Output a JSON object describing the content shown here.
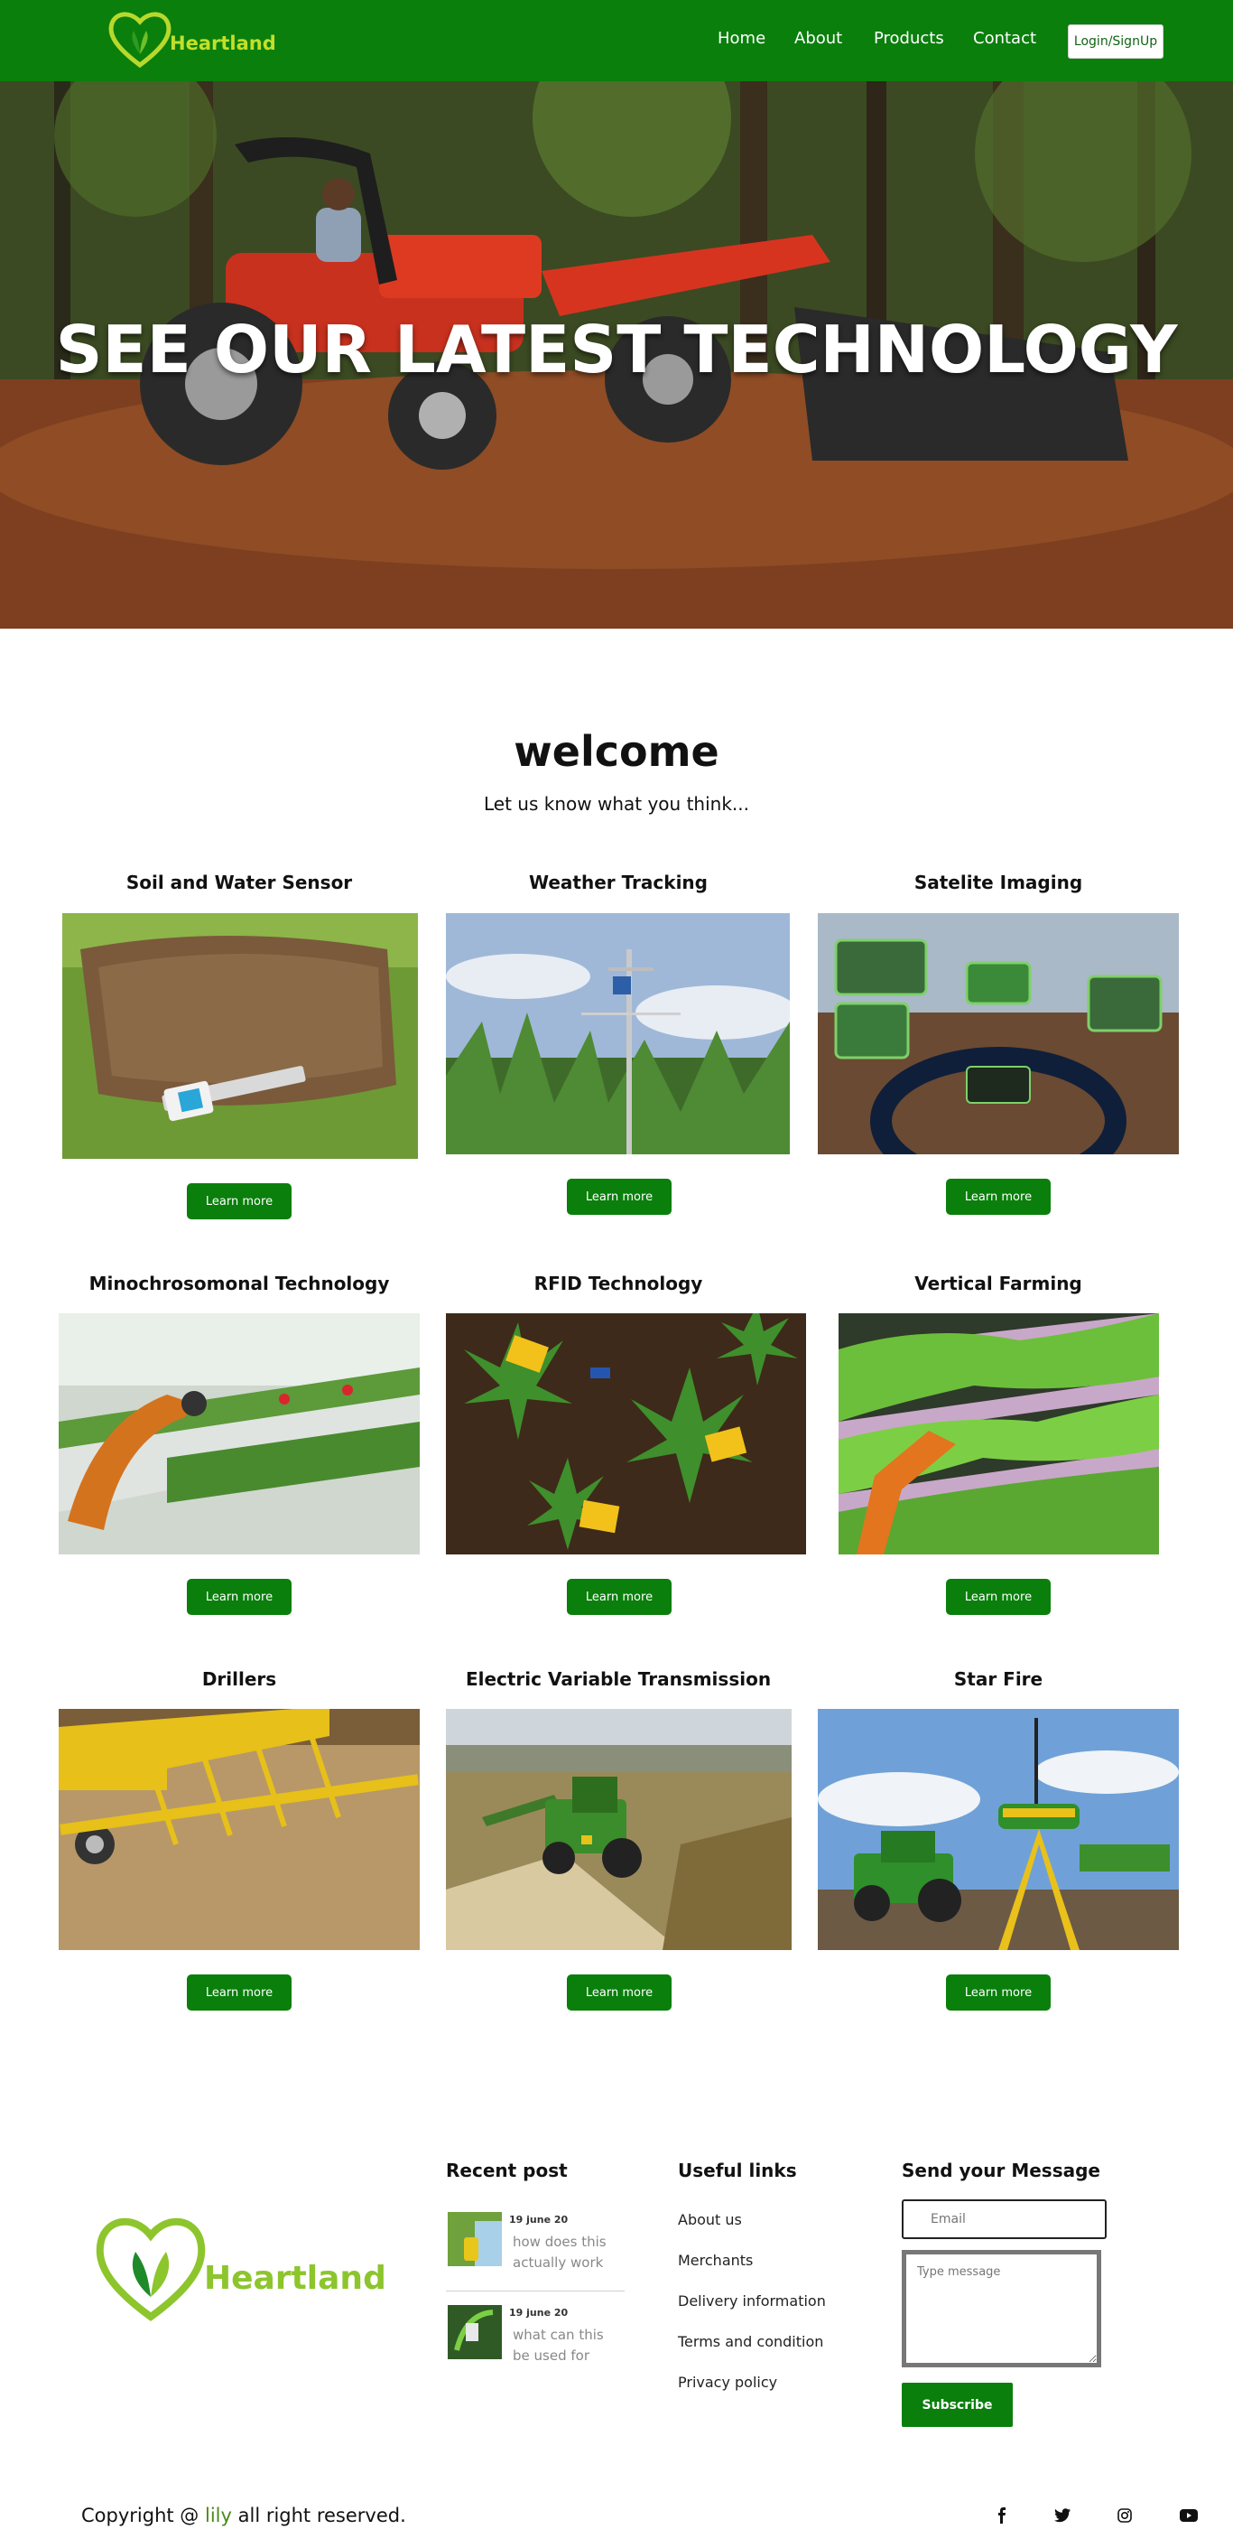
{
  "brand": {
    "name": "Heartland",
    "green": "#0a7f0c",
    "lime": "#c3df2b"
  },
  "nav": {
    "links": [
      "Home",
      "About",
      "Products",
      "Contact"
    ],
    "login_label": "Login/SignUp"
  },
  "hero": {
    "title": "SEE OUR LATEST TECHNOLOGY"
  },
  "welcome": {
    "title": "welcome",
    "subtitle": "Let us know what you think..."
  },
  "cards": [
    {
      "title": "Soil and Water Sensor",
      "button": "Learn more"
    },
    {
      "title": "Weather Tracking",
      "button": "Learn more"
    },
    {
      "title": "Satelite Imaging",
      "button": "Learn more"
    },
    {
      "title": "Minochrosomonal Technology",
      "button": "Learn more"
    },
    {
      "title": "RFID Technology",
      "button": "Learn more"
    },
    {
      "title": "Vertical Farming",
      "button": "Learn more"
    },
    {
      "title": "Drillers",
      "button": "Learn more"
    },
    {
      "title": "Electric Variable Transmission",
      "button": "Learn more"
    },
    {
      "title": "Star Fire",
      "button": "Learn more"
    }
  ],
  "footer": {
    "logo_text": "Heartland",
    "recent_post": {
      "heading": "Recent post",
      "posts": [
        {
          "date": "19 june 20",
          "text": "how does this actually work"
        },
        {
          "date": "19 june 20",
          "text": "what can this be used for"
        }
      ]
    },
    "useful_links": {
      "heading": "Useful links",
      "items": [
        "About us",
        "Merchants",
        "Delivery information",
        "Terms and condition",
        "Privacy policy"
      ]
    },
    "message": {
      "heading": "Send your Message",
      "email_placeholder": "Email",
      "message_placeholder": "Type message",
      "subscribe_label": "Subscribe"
    },
    "copyright": {
      "prefix": "Copyright @",
      "name": "lily",
      "suffix": "all right reserved."
    },
    "social_icons": [
      "facebook-icon",
      "twitter-icon",
      "instagram-icon",
      "youtube-icon"
    ]
  }
}
